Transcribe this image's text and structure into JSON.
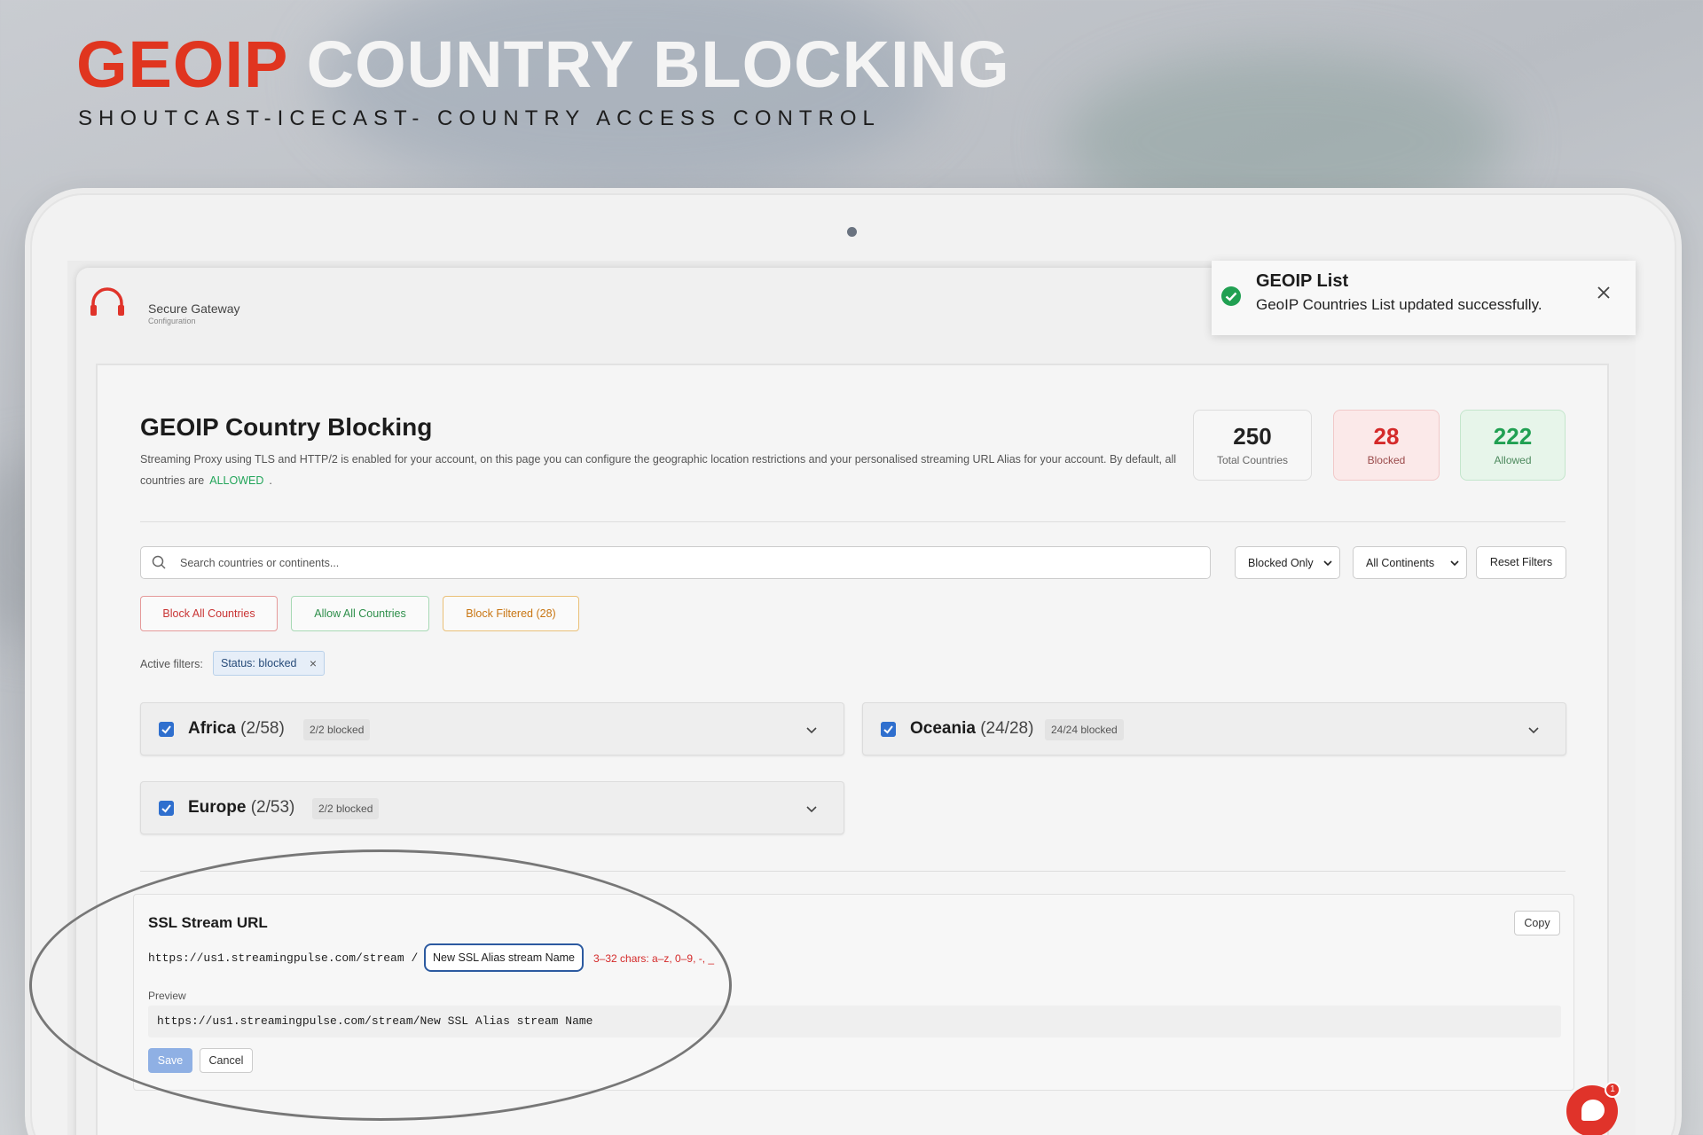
{
  "hero": {
    "title_accent": "GEOIP",
    "title_rest": "COUNTRY BLOCKING",
    "subtitle": "SHOUTCAST-ICECAST- COUNTRY ACCESS CONTROL"
  },
  "brand": {
    "name": "Secure Gateway",
    "subtitle": "Configuration",
    "logo_icon": "headphones-icon"
  },
  "toast": {
    "title": "GEOIP List",
    "message": "GeoIP Countries List updated successfully.",
    "icon": "check-circle-icon"
  },
  "page": {
    "title": "GEOIP Country Blocking",
    "description": "Streaming Proxy using TLS and HTTP/2 is enabled for your account, on this page you can configure the geographic location restrictions and your personalised streaming URL Alias for your account. By default, all countries are",
    "default_status": "ALLOWED",
    "description_end": "."
  },
  "stats": {
    "total": {
      "value": "250",
      "label": "Total Countries"
    },
    "blocked": {
      "value": "28",
      "label": "Blocked"
    },
    "allowed": {
      "value": "222",
      "label": "Allowed"
    }
  },
  "filters": {
    "search_placeholder": "Search countries or continents...",
    "status_select": "Blocked Only",
    "continent_select": "All Continents",
    "reset_label": "Reset Filters",
    "active_label": "Active filters:",
    "active_chip": "Status: blocked"
  },
  "actions": {
    "block_all": "Block All Countries",
    "allow_all": "Allow All Countries",
    "block_filtered": "Block Filtered (28)"
  },
  "regions": [
    {
      "name": "Africa",
      "count": "(2/58)",
      "badge": "2/2 blocked"
    },
    {
      "name": "Oceania",
      "count": "(24/28)",
      "badge": "24/24 blocked"
    },
    {
      "name": "Europe",
      "count": "(2/53)",
      "badge": "2/2 blocked"
    }
  ],
  "ssl": {
    "title": "SSL Stream URL",
    "copy_label": "Copy",
    "base_url": "https://us1.streamingpulse.com/stream /",
    "alias_value": "New SSL Alias stream Name",
    "hint": "3–32 chars: a–z, 0–9, -, _",
    "preview_label": "Preview",
    "preview_value": "https://us1.streamingpulse.com/stream/New SSL Alias stream Name",
    "save_label": "Save",
    "cancel_label": "Cancel"
  },
  "chat": {
    "badge": "1",
    "icon": "chat-icon"
  },
  "colors": {
    "accent": "#e0351f",
    "blocked": "#d42a2a",
    "allowed": "#21a052",
    "primary": "#2f6fce"
  }
}
